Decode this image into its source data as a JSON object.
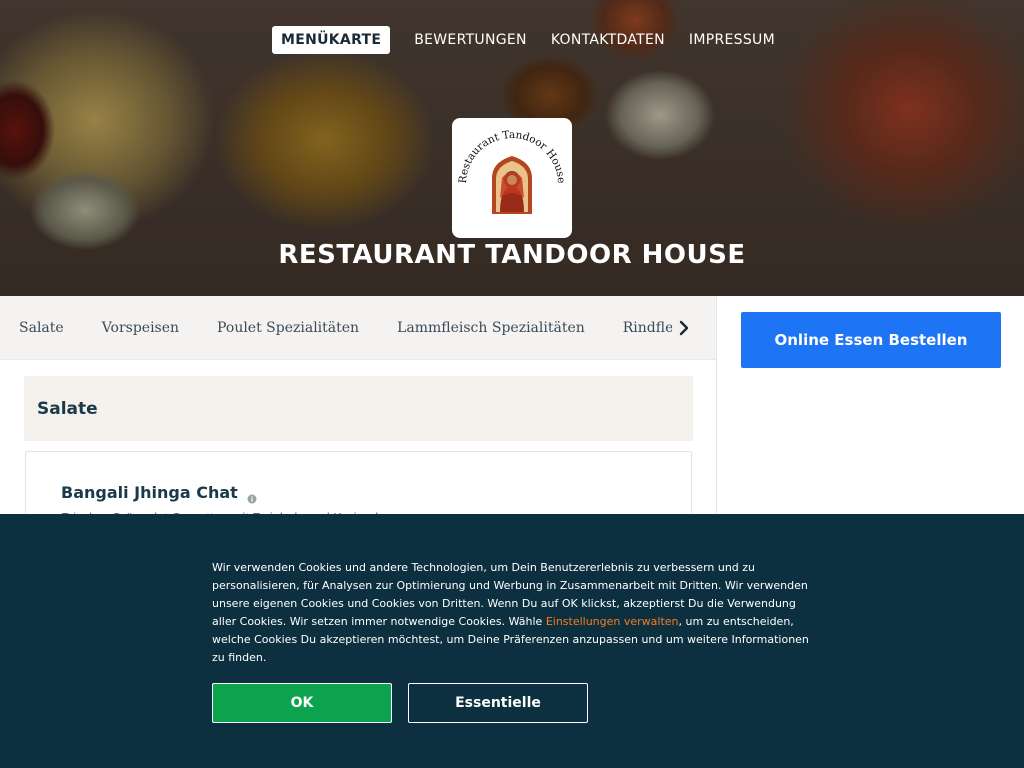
{
  "nav": {
    "items": [
      {
        "label": "MENÜKARTE",
        "active": true
      },
      {
        "label": "BEWERTUNGEN",
        "active": false
      },
      {
        "label": "KONTAKTDATEN",
        "active": false
      },
      {
        "label": "IMPRESSUM",
        "active": false
      }
    ]
  },
  "logo": {
    "text": "Restaurant Tandoor House"
  },
  "restaurant": {
    "name": "RESTAURANT TANDOOR HOUSE"
  },
  "categories": [
    "Salate",
    "Vorspeisen",
    "Poulet Spezialitäten",
    "Lammfleisch Spezialitäten",
    "Rindfleis"
  ],
  "menu": {
    "section_title": "Salate",
    "items": [
      {
        "name": "Bangali Jhinga Chat",
        "description": "Frischer Grünsalat Crevetten mit Zwiebeln und Koriander"
      }
    ]
  },
  "sidebar": {
    "order_button": "Online Essen Bestellen"
  },
  "cookie": {
    "text_before_link": "Wir verwenden Cookies und andere Technologien, um Dein Benutzererlebnis zu verbessern und zu personalisieren, für Analysen zur Optimierung und Werbung in Zusammenarbeit mit Dritten. Wir verwenden unsere eigenen Cookies und Cookies von Dritten. Wenn Du auf OK klickst, akzeptierst Du die Verwendung aller Cookies. Wir setzen immer notwendige Cookies. Wähle ",
    "link": "Einstellungen verwalten",
    "text_after_link": ", um zu entscheiden, welche Cookies Du akzeptieren möchtest, um Deine Präferenzen anzupassen und um weitere Informationen zu finden.",
    "ok_label": "OK",
    "essential_label": "Essentielle"
  },
  "colors": {
    "primary_button": "#1d74f5",
    "cookie_bg": "#0c3040",
    "ok_button": "#0ca34e",
    "link_orange": "#f57c1f"
  },
  "icons": {
    "next": "chevron-right-icon",
    "info": "info-icon"
  }
}
